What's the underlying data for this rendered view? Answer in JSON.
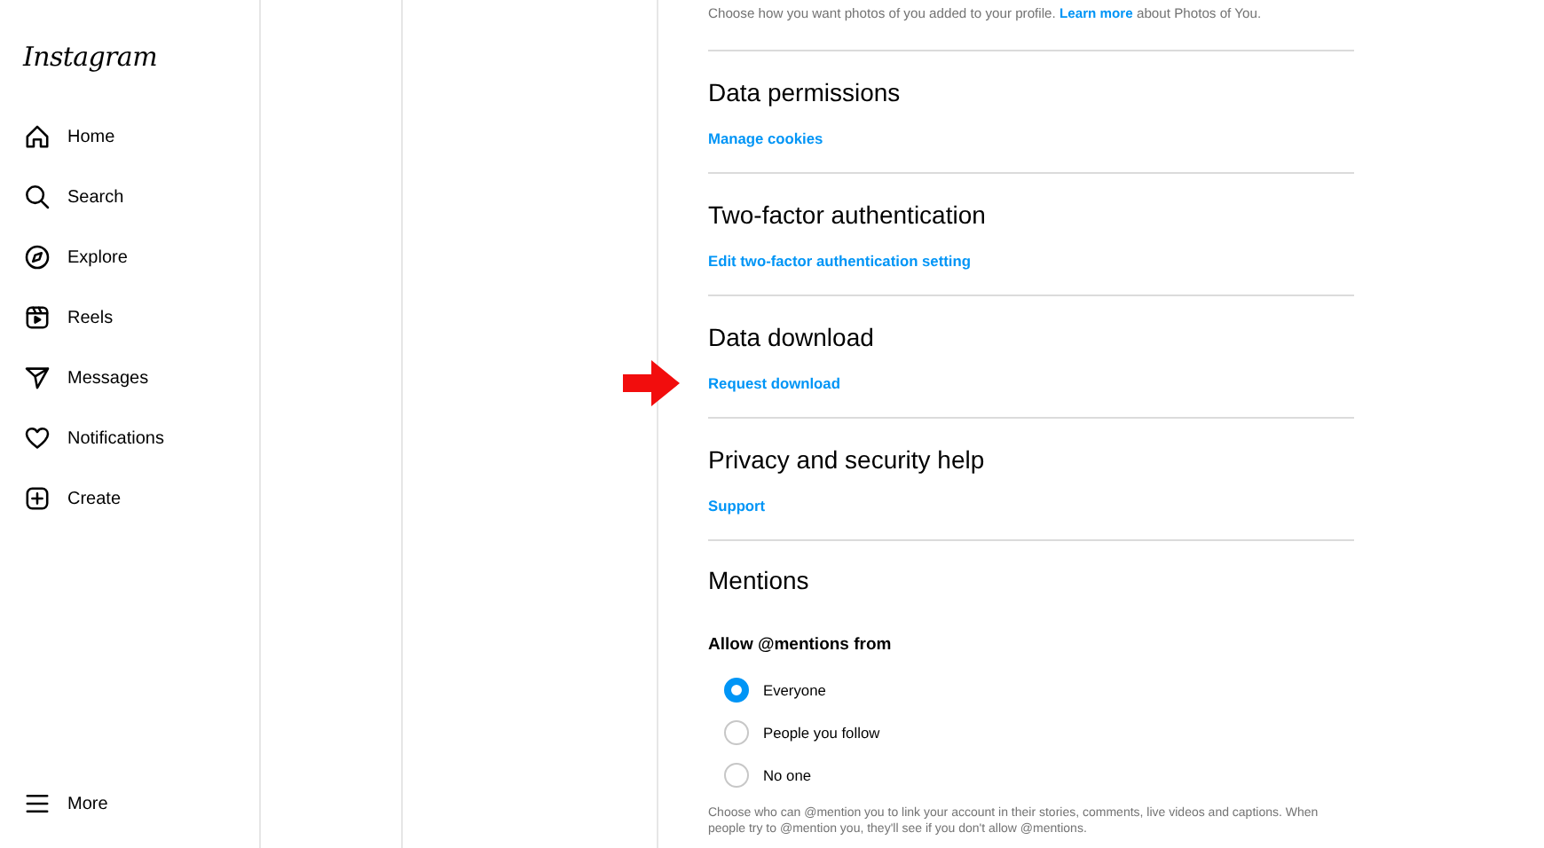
{
  "sidebar": {
    "logo": "Instagram",
    "items": [
      {
        "label": "Home"
      },
      {
        "label": "Search"
      },
      {
        "label": "Explore"
      },
      {
        "label": "Reels"
      },
      {
        "label": "Messages"
      },
      {
        "label": "Notifications"
      },
      {
        "label": "Create"
      }
    ],
    "more": {
      "label": "More"
    }
  },
  "settings": {
    "intro": {
      "before": "Choose how you want photos of you added to your profile. ",
      "link": "Learn more",
      "after": " about Photos of You."
    },
    "sections": [
      {
        "title": "Data permissions",
        "link": "Manage cookies",
        "pointed": false
      },
      {
        "title": "Two-factor authentication",
        "link": "Edit two-factor authentication setting",
        "pointed": false
      },
      {
        "title": "Data download",
        "link": "Request download",
        "pointed": true
      },
      {
        "title": "Privacy and security help",
        "link": "Support",
        "pointed": false
      }
    ],
    "mentions": {
      "title": "Mentions",
      "label": "Allow @mentions from",
      "options": [
        {
          "label": "Everyone",
          "selected": true
        },
        {
          "label": "People you follow",
          "selected": false
        },
        {
          "label": "No one",
          "selected": false
        }
      ],
      "note": "Choose who can @mention you to link your account in their stories, comments, live videos and captions. When people try to @mention you, they'll see if you don't allow @mentions."
    }
  }
}
